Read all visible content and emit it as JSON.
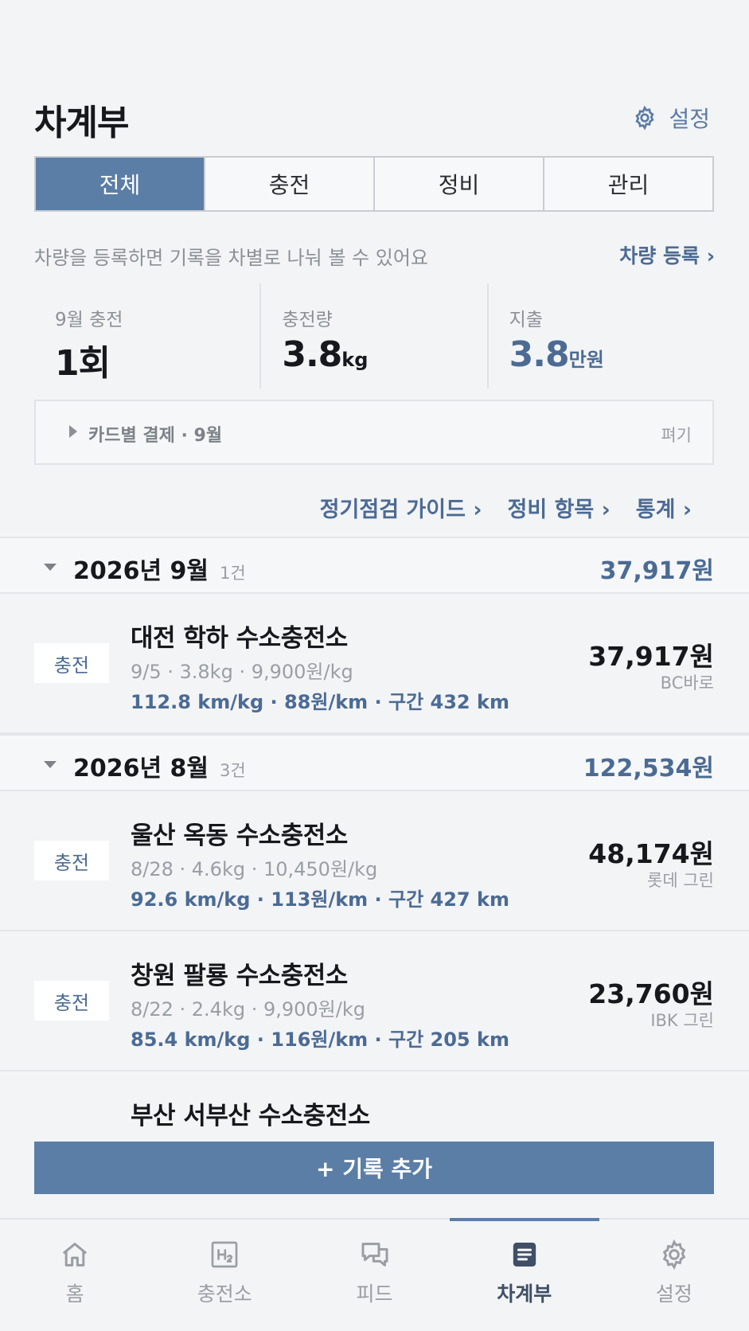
{
  "header": {
    "title": "차계부",
    "settings_label": "설정"
  },
  "tabs": [
    {
      "label": "전체",
      "active": true
    },
    {
      "label": "충전",
      "active": false
    },
    {
      "label": "정비",
      "active": false
    },
    {
      "label": "관리",
      "active": false
    }
  ],
  "notice": {
    "text": "차량을 등록하면 기록을 차별로 나눠 볼 수 있어요",
    "link": "차량 등록 ›"
  },
  "stats": [
    {
      "label": "9월 충전",
      "value": "1회",
      "unit": ""
    },
    {
      "label": "충전량",
      "value": "3.8",
      "unit": "kg"
    },
    {
      "label": "지출",
      "value": "3.8",
      "unit": "만원"
    }
  ],
  "card_payment": {
    "label": "카드별 결제 · 9월",
    "expand": "펴기"
  },
  "quick_links": [
    "정기점검 가이드 ›",
    "정비 항목 ›",
    "통계 ›"
  ],
  "months": [
    {
      "title": "2026년 9월",
      "count": "1건",
      "total": "37,917원",
      "records": [
        {
          "type": "충전",
          "name": "대전 학하 수소충전소",
          "meta": "9/5 · 3.8kg · 9,900원/kg",
          "eff": "112.8 km/kg · 88원/km · 구간 432 km",
          "amount": "37,917원",
          "card": "BC바로"
        }
      ]
    },
    {
      "title": "2026년 8월",
      "count": "3건",
      "total": "122,534원",
      "records": [
        {
          "type": "충전",
          "name": "울산 옥동 수소충전소",
          "meta": "8/28 · 4.6kg · 10,450원/kg",
          "eff": "92.6 km/kg · 113원/km · 구간 427 km",
          "amount": "48,174원",
          "card": "롯데 그린"
        },
        {
          "type": "충전",
          "name": "창원 팔룡 수소충전소",
          "meta": "8/22 · 2.4kg · 9,900원/kg",
          "eff": "85.4 km/kg · 116원/km · 구간 205 km",
          "amount": "23,760원",
          "card": "IBK 그린"
        },
        {
          "name": "부산 서부산 수소충전소"
        }
      ]
    }
  ],
  "add_button": "+ 기록 추가",
  "nav": [
    {
      "label": "홈",
      "icon": "home-icon",
      "active": false
    },
    {
      "label": "충전소",
      "icon": "h2-station-icon",
      "active": false
    },
    {
      "label": "피드",
      "icon": "chat-icon",
      "active": false
    },
    {
      "label": "차계부",
      "icon": "ledger-icon",
      "active": true
    },
    {
      "label": "설정",
      "icon": "gear-icon",
      "active": false
    }
  ],
  "colors": {
    "accent": "#5b7ea6",
    "accent_text": "#4b6b94",
    "background": "#f3f4f6"
  }
}
